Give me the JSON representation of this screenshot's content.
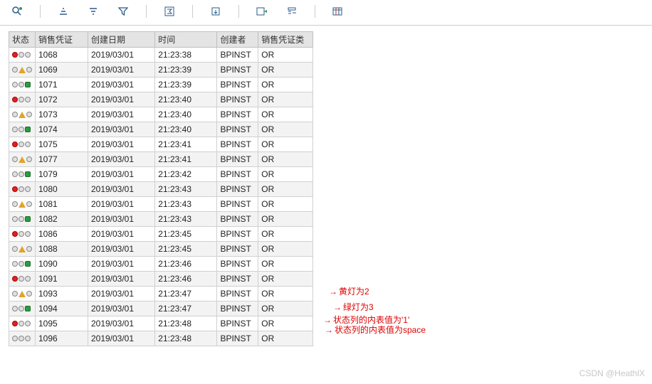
{
  "toolbar": {
    "icons": [
      "detail-icon",
      "sort-asc-icon",
      "sort-desc-icon",
      "filter-icon",
      "sum-icon",
      "export-icon",
      "send-icon",
      "layout-icon",
      "grid-settings-icon"
    ]
  },
  "columns": {
    "status": "状态",
    "doc": "销售凭证",
    "date": "创建日期",
    "time": "时间",
    "creator": "创建者",
    "type": "销售凭证类"
  },
  "rows": [
    {
      "status": "red",
      "doc": "1068",
      "date": "2019/03/01",
      "time": "21:23:38",
      "creator": "BPINST",
      "type": "OR"
    },
    {
      "status": "yellow",
      "doc": "1069",
      "date": "2019/03/01",
      "time": "21:23:39",
      "creator": "BPINST",
      "type": "OR"
    },
    {
      "status": "green",
      "doc": "1071",
      "date": "2019/03/01",
      "time": "21:23:39",
      "creator": "BPINST",
      "type": "OR"
    },
    {
      "status": "red",
      "doc": "1072",
      "date": "2019/03/01",
      "time": "21:23:40",
      "creator": "BPINST",
      "type": "OR"
    },
    {
      "status": "yellow",
      "doc": "1073",
      "date": "2019/03/01",
      "time": "21:23:40",
      "creator": "BPINST",
      "type": "OR"
    },
    {
      "status": "green",
      "doc": "1074",
      "date": "2019/03/01",
      "time": "21:23:40",
      "creator": "BPINST",
      "type": "OR"
    },
    {
      "status": "red",
      "doc": "1075",
      "date": "2019/03/01",
      "time": "21:23:41",
      "creator": "BPINST",
      "type": "OR"
    },
    {
      "status": "yellow",
      "doc": "1077",
      "date": "2019/03/01",
      "time": "21:23:41",
      "creator": "BPINST",
      "type": "OR"
    },
    {
      "status": "green",
      "doc": "1079",
      "date": "2019/03/01",
      "time": "21:23:42",
      "creator": "BPINST",
      "type": "OR"
    },
    {
      "status": "red",
      "doc": "1080",
      "date": "2019/03/01",
      "time": "21:23:43",
      "creator": "BPINST",
      "type": "OR"
    },
    {
      "status": "yellow",
      "doc": "1081",
      "date": "2019/03/01",
      "time": "21:23:43",
      "creator": "BPINST",
      "type": "OR"
    },
    {
      "status": "green",
      "doc": "1082",
      "date": "2019/03/01",
      "time": "21:23:43",
      "creator": "BPINST",
      "type": "OR"
    },
    {
      "status": "red",
      "doc": "1086",
      "date": "2019/03/01",
      "time": "21:23:45",
      "creator": "BPINST",
      "type": "OR"
    },
    {
      "status": "yellow",
      "doc": "1088",
      "date": "2019/03/01",
      "time": "21:23:45",
      "creator": "BPINST",
      "type": "OR"
    },
    {
      "status": "green",
      "doc": "1090",
      "date": "2019/03/01",
      "time": "21:23:46",
      "creator": "BPINST",
      "type": "OR"
    },
    {
      "status": "red",
      "doc": "1091",
      "date": "2019/03/01",
      "time": "21:23:46",
      "creator": "BPINST",
      "type": "OR"
    },
    {
      "status": "yellow",
      "doc": "1093",
      "date": "2019/03/01",
      "time": "21:23:47",
      "creator": "BPINST",
      "type": "OR"
    },
    {
      "status": "green",
      "doc": "1094",
      "date": "2019/03/01",
      "time": "21:23:47",
      "creator": "BPINST",
      "type": "OR"
    },
    {
      "status": "red",
      "doc": "1095",
      "date": "2019/03/01",
      "time": "21:23:48",
      "creator": "BPINST",
      "type": "OR"
    },
    {
      "status": "space",
      "doc": "1096",
      "date": "2019/03/01",
      "time": "21:23:48",
      "creator": "BPINST",
      "type": "OR"
    }
  ],
  "annotations": {
    "a1": "黄灯为2",
    "a2": "绿灯为3",
    "a3": "状态列的内表值为'1'",
    "a4": "状态列的内表值为space"
  },
  "watermark": "CSDN @HeathlX"
}
